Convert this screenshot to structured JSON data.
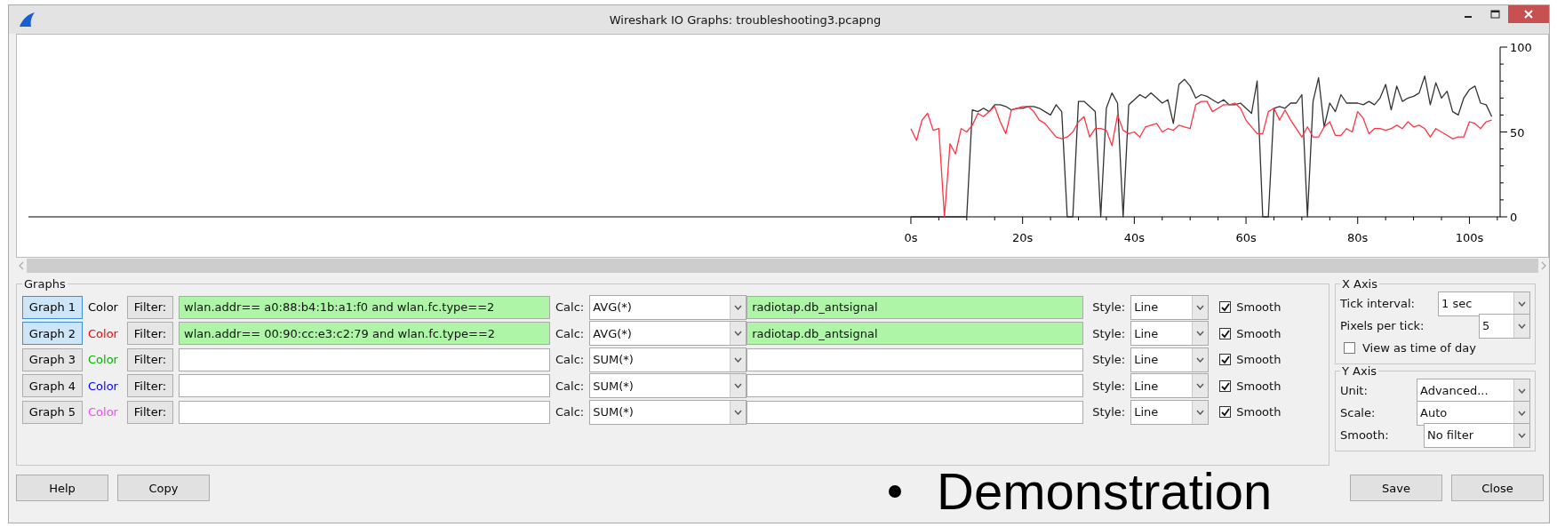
{
  "window": {
    "title": "Wireshark IO Graphs: troubleshooting3.pcapng"
  },
  "chart_data": {
    "type": "line",
    "x": [
      0,
      1,
      2,
      3,
      4,
      5,
      6,
      7,
      8,
      9,
      10,
      11,
      12,
      13,
      14,
      15,
      16,
      17,
      18,
      19,
      20,
      21,
      22,
      23,
      24,
      25,
      26,
      27,
      28,
      29,
      30,
      31,
      32,
      33,
      34,
      35,
      36,
      37,
      38,
      39,
      40,
      41,
      42,
      43,
      44,
      45,
      46,
      47,
      48,
      49,
      50,
      51,
      52,
      53,
      54,
      55,
      56,
      57,
      58,
      59,
      60,
      61,
      62,
      63,
      64,
      65,
      66,
      67,
      68,
      69,
      70,
      71,
      72,
      73,
      74,
      75,
      76,
      77,
      78,
      79,
      80,
      81,
      82,
      83,
      84,
      85,
      86,
      87,
      88,
      89,
      90,
      91,
      92,
      93,
      94,
      95,
      96,
      97,
      98,
      99,
      100,
      101,
      102,
      103,
      104
    ],
    "series": [
      {
        "color": "#333333",
        "values": [
          0,
          0,
          0,
          0,
          0,
          0,
          0,
          0,
          0,
          0,
          0,
          63,
          62,
          64,
          62,
          66,
          66,
          65,
          63,
          64,
          64,
          65,
          65,
          64,
          62,
          60,
          66,
          62,
          0,
          0,
          68,
          68,
          65,
          62,
          0,
          64,
          73,
          67,
          0,
          66,
          69,
          72,
          70,
          73,
          70,
          67,
          69,
          55,
          78,
          81,
          77,
          70,
          72,
          71,
          69,
          67,
          69,
          66,
          66,
          67,
          64,
          61,
          80,
          0,
          0,
          64,
          65,
          64,
          67,
          67,
          72,
          0,
          68,
          82,
          53,
          67,
          62,
          72,
          67,
          67,
          67,
          66,
          68,
          66,
          70,
          78,
          63,
          77,
          68,
          70,
          71,
          73,
          83,
          66,
          79,
          70,
          74,
          62,
          60,
          70,
          75,
          77,
          67,
          66,
          59
        ]
      },
      {
        "color": "#ff3344",
        "values": [
          52,
          45,
          57,
          61,
          51,
          52,
          0,
          43,
          37,
          52,
          50,
          54,
          61,
          59,
          62,
          65,
          56,
          49,
          63,
          64,
          65,
          65,
          62,
          57,
          55,
          51,
          47,
          46,
          47,
          50,
          56,
          59,
          47,
          52,
          52,
          51,
          42,
          60,
          51,
          49,
          50,
          47,
          53,
          54,
          55,
          50,
          52,
          51,
          54,
          53,
          52,
          66,
          68,
          68,
          62,
          64,
          66,
          66,
          67,
          64,
          57,
          53,
          49,
          49,
          62,
          64,
          57,
          63,
          57,
          52,
          47,
          53,
          47,
          47,
          53,
          56,
          48,
          48,
          52,
          50,
          62,
          58,
          49,
          52,
          52,
          51,
          52,
          54,
          52,
          56,
          53,
          54,
          52,
          47,
          52,
          50,
          48,
          46,
          47,
          47,
          56,
          55,
          52,
          56,
          57
        ]
      }
    ],
    "xlim": [
      -158,
      105.5
    ],
    "ylim": [
      0,
      100
    ],
    "xticks": [
      {
        "value": 0,
        "label": "0s"
      },
      {
        "value": 20,
        "label": "20s"
      },
      {
        "value": 40,
        "label": "40s"
      },
      {
        "value": 60,
        "label": "60s"
      },
      {
        "value": 80,
        "label": "80s"
      },
      {
        "value": 100,
        "label": "100s"
      }
    ],
    "yticks": [
      0,
      50,
      100
    ]
  },
  "graphs_panel": {
    "title": "Graphs"
  },
  "graphs": [
    {
      "button": "Graph 1",
      "on": true,
      "color_label": "Color",
      "color": "#000000",
      "filter_button": "Filter:",
      "filter": "wlan.addr== a0:88:b4:1b:a1:f0 and wlan.fc.type==2",
      "calc_label": "Calc:",
      "calc": "AVG(*)",
      "calc_field": "radiotap.db_antsignal",
      "style_label": "Style:",
      "style": "Line",
      "smooth": true,
      "smooth_label": "Smooth"
    },
    {
      "button": "Graph 2",
      "on": true,
      "color_label": "Color",
      "color": "#ff0000",
      "filter_button": "Filter:",
      "filter": "wlan.addr== 00:90:cc:e3:c2:79 and wlan.fc.type==2",
      "calc_label": "Calc:",
      "calc": "AVG(*)",
      "calc_field": "radiotap.db_antsignal",
      "style_label": "Style:",
      "style": "Line",
      "smooth": true,
      "smooth_label": "Smooth"
    },
    {
      "button": "Graph 3",
      "on": false,
      "color_label": "Color",
      "color": "#00b400",
      "filter_button": "Filter:",
      "calc_label": "Calc:",
      "calc": "SUM(*)",
      "style_label": "Style:",
      "style": "Line",
      "smooth": true,
      "smooth_label": "Smooth"
    },
    {
      "button": "Graph 4",
      "on": false,
      "color_label": "Color",
      "color": "#0000ff",
      "filter_button": "Filter:",
      "calc_label": "Calc:",
      "calc": "SUM(*)",
      "style_label": "Style:",
      "style": "Line",
      "smooth": true,
      "smooth_label": "Smooth"
    },
    {
      "button": "Graph 5",
      "on": false,
      "color_label": "Color",
      "color": "#ff40ff",
      "filter_button": "Filter:",
      "calc_label": "Calc:",
      "calc": "SUM(*)",
      "style_label": "Style:",
      "style": "Line",
      "smooth": true,
      "smooth_label": "Smooth"
    }
  ],
  "x_axis": {
    "title": "X Axis",
    "tick_interval_label": "Tick interval:",
    "tick_interval": "1 sec",
    "pixels_label": "Pixels per tick:",
    "pixels": "5",
    "time_of_day_label": "View as time of day",
    "time_of_day": false
  },
  "y_axis": {
    "title": "Y Axis",
    "unit_label": "Unit:",
    "unit": "Advanced...",
    "scale_label": "Scale:",
    "scale": "Auto",
    "smooth_label": "Smooth:",
    "smooth": "No filter"
  },
  "buttons": {
    "left": [
      "Help",
      "Copy"
    ],
    "right": [
      "Save",
      "Close"
    ]
  },
  "overlay": {
    "text": "Demonstration"
  }
}
